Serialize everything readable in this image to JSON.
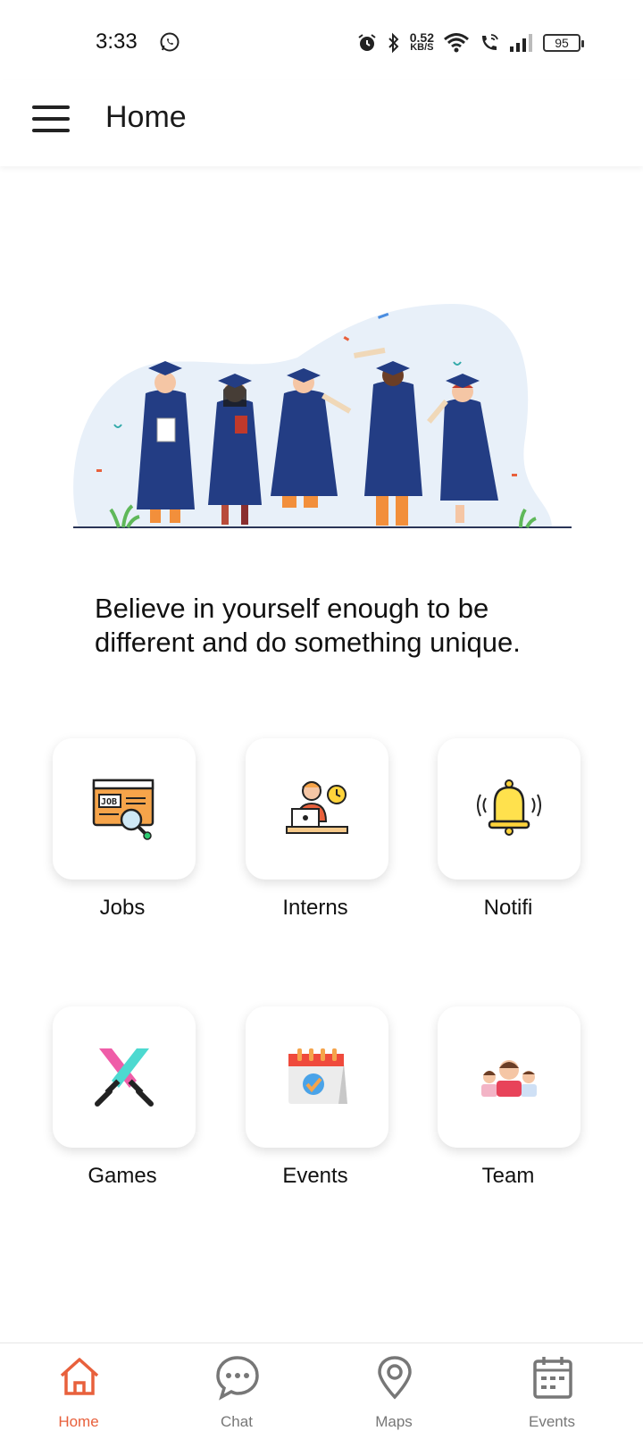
{
  "status_bar": {
    "time": "3:33",
    "speed_value": "0.52",
    "speed_unit": "KB/S",
    "battery": "95",
    "icons": [
      "whatsapp-icon",
      "alarm-icon",
      "bluetooth-icon",
      "wifi-icon",
      "wifi-calling-icon",
      "signal-icon",
      "battery-icon"
    ]
  },
  "app_bar": {
    "title": "Home",
    "menu_icon": "hamburger-menu-icon"
  },
  "hero": {
    "illustration": "graduation-illustration"
  },
  "quote": "Believe in yourself enough to be different and do something unique.",
  "tiles": [
    {
      "label": "Jobs",
      "icon": "jobs-icon"
    },
    {
      "label": "Interns",
      "icon": "interns-icon"
    },
    {
      "label": "Notifi",
      "icon": "bell-icon"
    },
    {
      "label": "Games",
      "icon": "games-swords-icon"
    },
    {
      "label": "Events",
      "icon": "calendar-event-icon"
    },
    {
      "label": "Team",
      "icon": "team-icon"
    }
  ],
  "bottom_nav": [
    {
      "label": "Home",
      "icon": "home-icon",
      "active": true
    },
    {
      "label": "Chat",
      "icon": "chat-icon",
      "active": false
    },
    {
      "label": "Maps",
      "icon": "map-pin-icon",
      "active": false
    },
    {
      "label": "Events",
      "icon": "calendar-icon",
      "active": false
    }
  ],
  "colors": {
    "accent": "#e8603c",
    "inactive": "#777777",
    "gown": "#233d84",
    "hero_blob": "#e8f0f9"
  }
}
